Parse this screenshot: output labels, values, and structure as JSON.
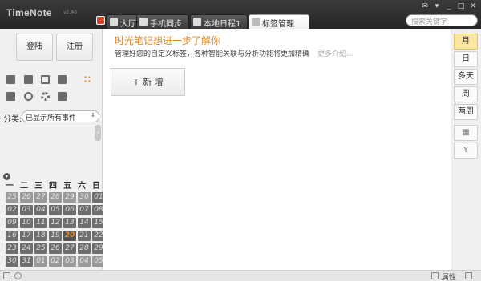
{
  "app": {
    "title": "TimeNote",
    "version": "v2.40"
  },
  "tabs": [
    {
      "label": "大厅"
    },
    {
      "label": "手机同步"
    },
    {
      "label": "本地日程1"
    },
    {
      "label": "标签管理"
    }
  ],
  "search": {
    "placeholder": "搜索关键字"
  },
  "window_buttons": [
    "mail-icon",
    "menu-icon",
    "minimize-icon",
    "maximize-icon",
    "close-icon"
  ],
  "sidebar": {
    "login_label": "登陆",
    "register_label": "注册",
    "toolbar_icons": [
      "folder-open-icon",
      "new-file-icon",
      "save-icon",
      "edit-icon",
      "grid-icon",
      "copy-icon",
      "undo-icon",
      "settings-icon",
      "clipboard-icon"
    ],
    "category_label": "分类:",
    "category_value": "已显示所有事件"
  },
  "calendar": {
    "weekdays": [
      "一",
      "二",
      "三",
      "四",
      "五",
      "六",
      "日"
    ],
    "weeks": [
      [
        "25",
        "26",
        "27",
        "28",
        "29",
        "30",
        "01"
      ],
      [
        "02",
        "03",
        "04",
        "05",
        "06",
        "07",
        "08"
      ],
      [
        "09",
        "10",
        "11",
        "12",
        "13",
        "14",
        "15"
      ],
      [
        "16",
        "17",
        "18",
        "19",
        "20",
        "21",
        "22"
      ],
      [
        "23",
        "24",
        "25",
        "26",
        "27",
        "28",
        "29"
      ],
      [
        "30",
        "31",
        "01",
        "02",
        "03",
        "04",
        "05"
      ]
    ],
    "today": "20"
  },
  "main": {
    "headline": "时光笔记想进一步了解你",
    "description": "管理好您的自定义标签，各种智能关联与分析功能将更加精确",
    "more_link": "更多介绍...",
    "add_button": "+ 新 增"
  },
  "view_switcher": {
    "views": [
      {
        "label": "月",
        "selected": true
      },
      {
        "label": "日",
        "selected": false
      },
      {
        "label": "多天",
        "selected": false
      },
      {
        "label": "周",
        "selected": false
      },
      {
        "label": "两周",
        "selected": false
      }
    ],
    "extra_icons": [
      "calendar-grid-icon",
      "sprout-icon"
    ]
  },
  "statusbar": {
    "label": "属性"
  },
  "colors": {
    "accent": "#e08a24",
    "titlebar": "#2e2e2e",
    "selected_view": "#f9e7a1"
  }
}
